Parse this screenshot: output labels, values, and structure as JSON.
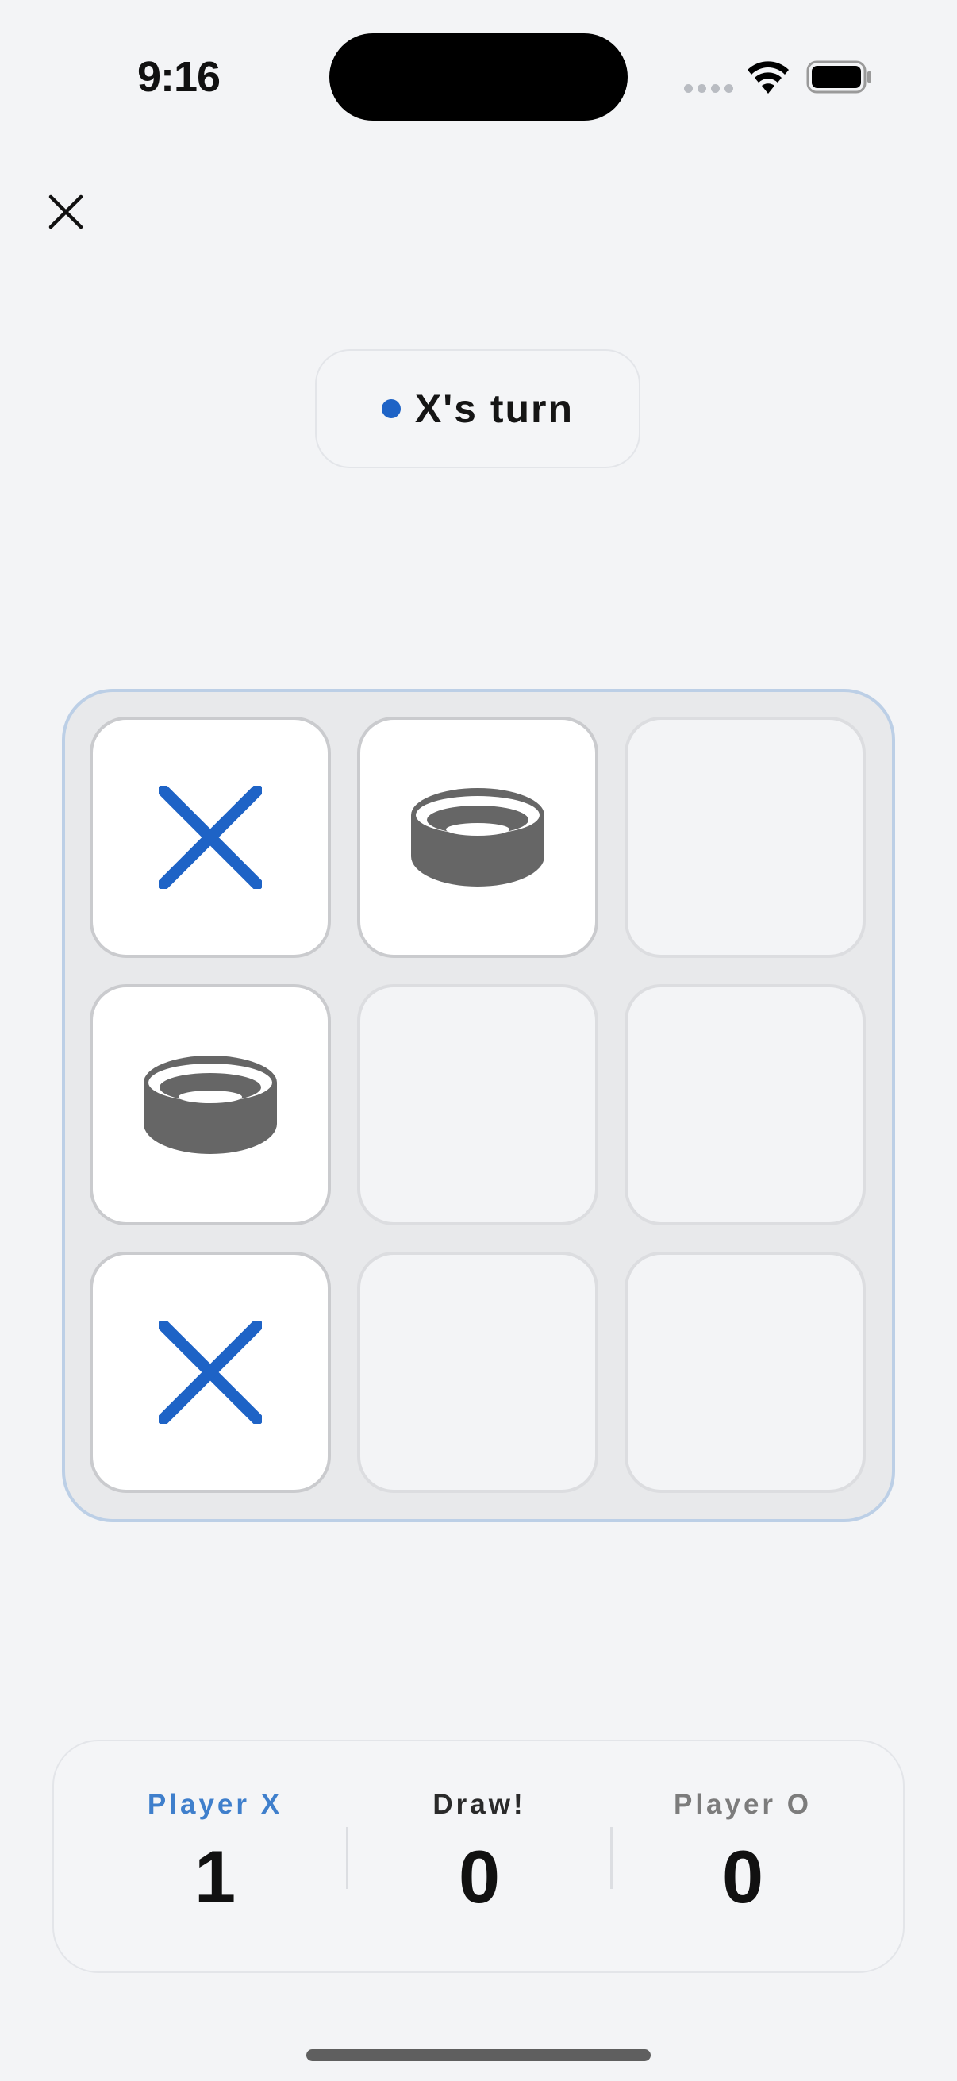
{
  "status_bar": {
    "time": "9:16",
    "wifi_icon": "wifi-icon",
    "battery_icon": "battery-full-icon"
  },
  "header": {
    "close_icon": "close-icon"
  },
  "turn": {
    "text": "X's turn",
    "dot_color": "#1e63c6"
  },
  "board": {
    "cells": [
      "X",
      "O",
      "",
      "O",
      "",
      "",
      "X",
      "",
      ""
    ],
    "x_color": "#1e63c6",
    "o_color": "#666666"
  },
  "scores": {
    "player_x": {
      "label": "Player X",
      "value": "1",
      "color": "#3f7fcc"
    },
    "draw": {
      "label": "Draw!",
      "value": "0",
      "color": "#2a2a2a"
    },
    "player_o": {
      "label": "Player O",
      "value": "0",
      "color": "#7c7c7c"
    }
  }
}
